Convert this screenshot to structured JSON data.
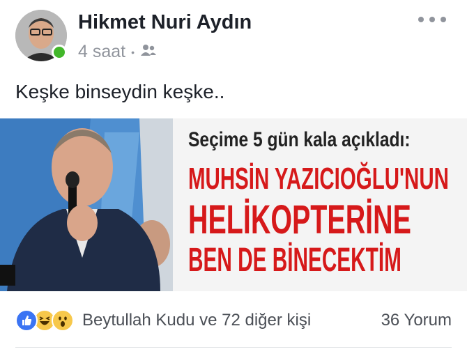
{
  "post": {
    "author_name": "Hikmet Nuri Aydın",
    "timestamp": "4 saat",
    "separator": "•",
    "audience_icon": "friends-icon",
    "more_icon": "more-horizontal-icon",
    "text": "Keşke binseydin keşke.."
  },
  "image": {
    "headline_sub": "Seçime 5 gün kala açıkladı:",
    "headline_line1": "MUHSİN YAZICIOĞLU'NUN",
    "headline_line2": "HELİKOPTERİNE",
    "headline_line3": "BEN DE BİNECEKTİM",
    "headline_color": "#d6191a"
  },
  "footer": {
    "reaction_icons": [
      "like-icon",
      "haha-icon",
      "wow-icon"
    ],
    "reactions_text": "Beytullah Kudu ve 72 diğer kişi",
    "comments_text": "36 Yorum"
  },
  "colors": {
    "online": "#42b72a",
    "meta": "#90949c",
    "like": "#3b74f3"
  }
}
